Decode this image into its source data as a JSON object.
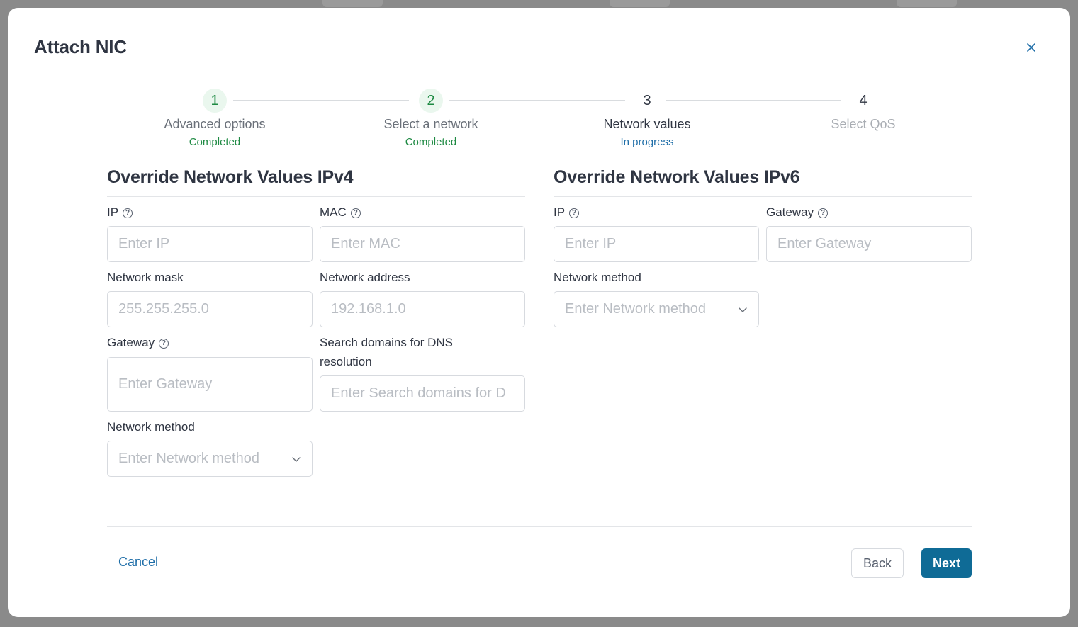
{
  "modal": {
    "title": "Attach NIC"
  },
  "stepper": {
    "steps": [
      {
        "number": "1",
        "label": "Advanced options",
        "status": "Completed"
      },
      {
        "number": "2",
        "label": "Select a network",
        "status": "Completed"
      },
      {
        "number": "3",
        "label": "Network values",
        "status": "In progress"
      },
      {
        "number": "4",
        "label": "Select QoS",
        "status": ""
      }
    ]
  },
  "ipv4": {
    "title": "Override Network Values IPv4",
    "ip_label": "IP",
    "ip_placeholder": "Enter IP",
    "mac_label": "MAC",
    "mac_placeholder": "Enter MAC",
    "mask_label": "Network mask",
    "mask_placeholder": "255.255.255.0",
    "address_label": "Network address",
    "address_placeholder": "192.168.1.0",
    "gateway_label": "Gateway",
    "gateway_placeholder": "Enter Gateway",
    "dns_label": "Search domains for DNS resolution",
    "dns_placeholder": "Enter Search domains for D",
    "method_label": "Network method",
    "method_placeholder": "Enter Network method"
  },
  "ipv6": {
    "title": "Override Network Values IPv6",
    "ip_label": "IP",
    "ip_placeholder": "Enter IP",
    "gateway_label": "Gateway",
    "gateway_placeholder": "Enter Gateway",
    "method_label": "Network method",
    "method_placeholder": "Enter Network method"
  },
  "footer": {
    "cancel_label": "Cancel",
    "back_label": "Back",
    "next_label": "Next"
  },
  "colors": {
    "primary": "#0f6b96",
    "completed": "#1e8a43",
    "in_progress": "#1f6ea8"
  }
}
